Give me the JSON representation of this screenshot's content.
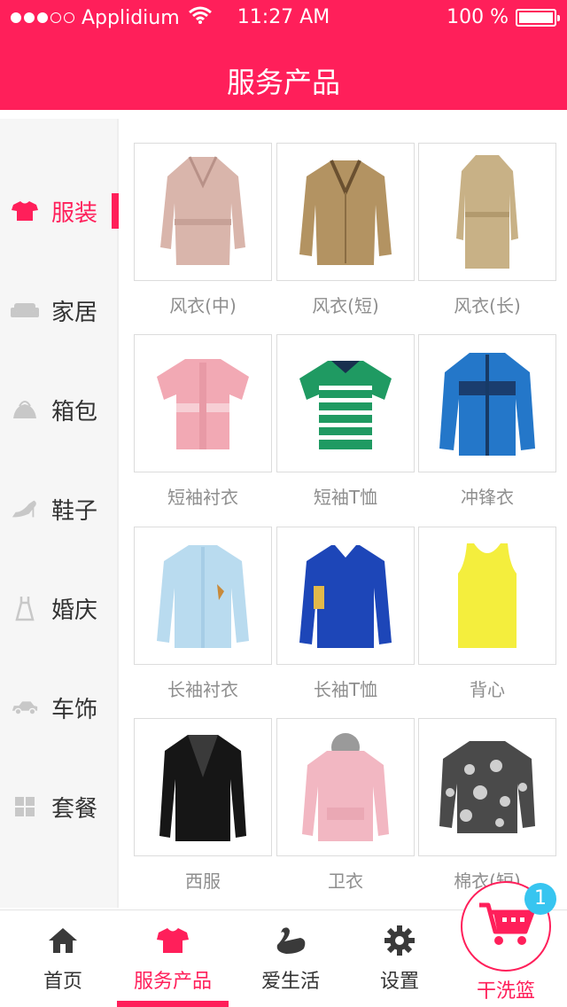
{
  "status_bar": {
    "carrier": "Applidium",
    "time": "11:27  AM",
    "battery": "100  %",
    "battery_level": 1.0,
    "signal_dots_filled": 3,
    "signal_dots_total": 5
  },
  "header": {
    "title": "服务产品"
  },
  "colors": {
    "accent": "#ff1f5a",
    "badge": "#37c5f0"
  },
  "sidebar": {
    "items": [
      {
        "label": "服装",
        "icon": "tshirt-icon",
        "active": true
      },
      {
        "label": "家居",
        "icon": "sofa-icon",
        "active": false
      },
      {
        "label": "箱包",
        "icon": "bag-icon",
        "active": false
      },
      {
        "label": "鞋子",
        "icon": "high-heel-icon",
        "active": false
      },
      {
        "label": "婚庆",
        "icon": "dress-icon",
        "active": false
      },
      {
        "label": "车饰",
        "icon": "car-icon",
        "active": false
      },
      {
        "label": "套餐",
        "icon": "grid-icon",
        "active": false
      }
    ]
  },
  "products": [
    {
      "label": "风衣(中)",
      "image": "trench-coat-pink"
    },
    {
      "label": "风衣(短)",
      "image": "trench-coat-khaki"
    },
    {
      "label": "风衣(长)",
      "image": "trench-coat-beige"
    },
    {
      "label": "短袖衬衣",
      "image": "short-sleeve-shirt-pink"
    },
    {
      "label": "短袖T恤",
      "image": "polo-striped-green"
    },
    {
      "label": "冲锋衣",
      "image": "jacket-blue"
    },
    {
      "label": "长袖衬衣",
      "image": "long-sleeve-shirt-lightblue"
    },
    {
      "label": "长袖T恤",
      "image": "polo-long-blue"
    },
    {
      "label": "背心",
      "image": "tank-top-yellow"
    },
    {
      "label": "西服",
      "image": "blazer-black"
    },
    {
      "label": "卫衣",
      "image": "hoodie-pink"
    },
    {
      "label": "棉衣(短)",
      "image": "padded-jacket-print"
    }
  ],
  "tabbar": {
    "items": [
      {
        "label": "首页",
        "icon": "home-icon",
        "active": false
      },
      {
        "label": "服务产品",
        "icon": "tshirt-icon",
        "active": true
      },
      {
        "label": "爱生活",
        "icon": "swan-icon",
        "active": false
      },
      {
        "label": "设置",
        "icon": "gear-icon",
        "active": false
      }
    ],
    "basket": {
      "label": "干洗篮",
      "icon": "cart-icon",
      "badge": "1"
    }
  }
}
